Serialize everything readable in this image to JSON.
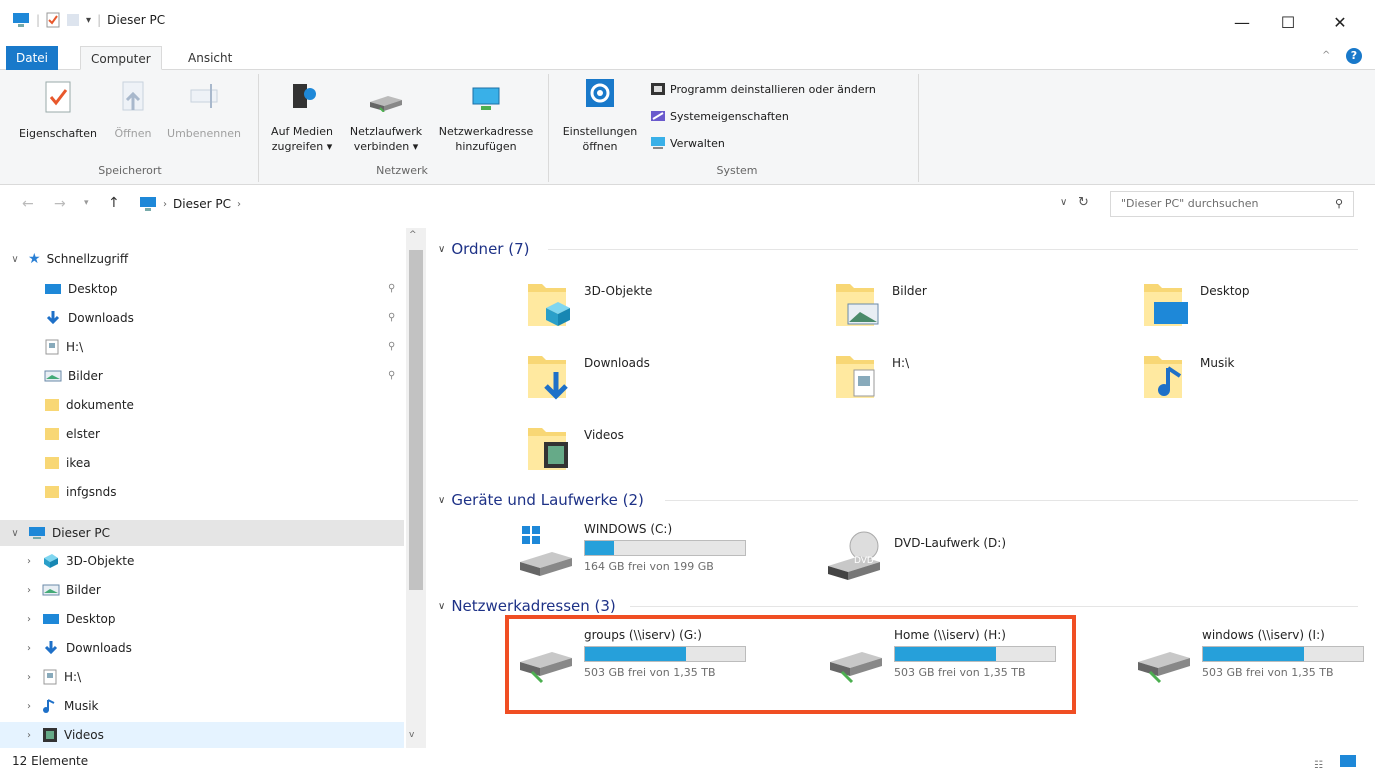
{
  "window": {
    "title": "Dieser PC",
    "minimize": "—",
    "maximize": "☐",
    "close": "✕"
  },
  "tabs": {
    "file": "Datei",
    "computer": "Computer",
    "view": "Ansicht"
  },
  "ribbon": {
    "speicherort": {
      "label": "Speicherort",
      "eigenschaften": "Eigenschaften",
      "oeffnen": "Öffnen",
      "umbenennen": "Umbenennen"
    },
    "netzwerk": {
      "label": "Netzwerk",
      "medien_1": "Auf Medien",
      "medien_2": "zugreifen ▾",
      "netzlaufwerk_1": "Netzlaufwerk",
      "netzlaufwerk_2": "verbinden ▾",
      "netzadresse_1": "Netzwerkadresse",
      "netzadresse_2": "hinzufügen"
    },
    "system": {
      "label": "System",
      "einstellungen_1": "Einstellungen",
      "einstellungen_2": "öffnen",
      "programm": "Programm deinstallieren oder ändern",
      "systemeigenschaften": "Systemeigenschaften",
      "verwalten": "Verwalten"
    }
  },
  "address": {
    "location": "Dieser PC",
    "search_placeholder": "\"Dieser PC\" durchsuchen"
  },
  "nav": {
    "quick_access": "Schnellzugriff",
    "quick_items": [
      "Desktop",
      "Downloads",
      "H:\\",
      "Bilder",
      "dokumente",
      "elster",
      "ikea",
      "infgsnds"
    ],
    "this_pc": "Dieser PC",
    "pc_items": [
      "3D-Objekte",
      "Bilder",
      "Desktop",
      "Downloads",
      "H:\\",
      "Musik",
      "Videos"
    ]
  },
  "sections": {
    "folders": "Ordner (7)",
    "devices": "Geräte und Laufwerke (2)",
    "network": "Netzwerkadressen (3)"
  },
  "folders": [
    "3D-Objekte",
    "Bilder",
    "Desktop",
    "Downloads",
    "H:\\",
    "Musik",
    "Videos"
  ],
  "drives": [
    {
      "name": "WINDOWS (C:)",
      "free": "164 GB frei von 199 GB",
      "used_fraction": 0.18
    },
    {
      "name": "DVD-Laufwerk (D:)",
      "dvd_label": "DVD"
    }
  ],
  "network_drives": [
    {
      "name": "groups (\\\\iserv) (G:)",
      "free": "503 GB frei von 1,35 TB",
      "used_fraction": 0.63
    },
    {
      "name": "Home (\\\\iserv) (H:)",
      "free": "503 GB frei von 1,35 TB",
      "used_fraction": 0.63
    },
    {
      "name": "windows (\\\\iserv) (I:)",
      "free": "503 GB frei von 1,35 TB",
      "used_fraction": 0.63
    }
  ],
  "status": {
    "count": "12 Elemente"
  },
  "colors": {
    "accent": "#1979ca",
    "highlight": "#f04e23",
    "bar_fill": "#26a0da",
    "folder": "#f8d775"
  }
}
